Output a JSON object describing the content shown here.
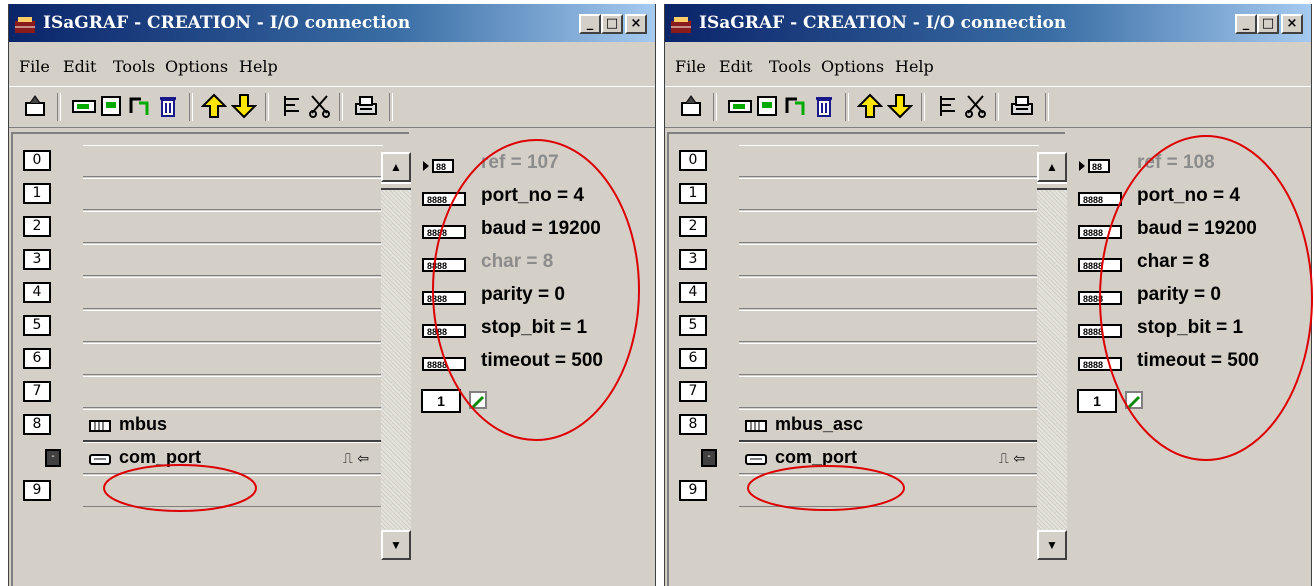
{
  "colors": {
    "titlebar_start": "#0a246a",
    "titlebar_end": "#a6caf0",
    "window": "#d4d0c8",
    "annotation": "#dd0000"
  },
  "windows": [
    {
      "title": "ISaGRAF - CREATION - I/O connection",
      "controls": {
        "minimize": "_",
        "maximize": "□",
        "close": "×"
      },
      "menu": [
        {
          "label": "File"
        },
        {
          "label": "Edit"
        },
        {
          "label": "Tools"
        },
        {
          "label": "Options"
        },
        {
          "label": "Help"
        }
      ],
      "toolbar_icons": [
        "open-icon",
        "board-connect-icon",
        "board-params-icon",
        "board-swap-icon",
        "trash-icon",
        "arrow-up-icon",
        "arrow-down-icon",
        "list-icon",
        "scissors-icon",
        "printer-icon"
      ],
      "slots": [
        {
          "num": "0",
          "name": ""
        },
        {
          "num": "1",
          "name": ""
        },
        {
          "num": "2",
          "name": ""
        },
        {
          "num": "3",
          "name": ""
        },
        {
          "num": "4",
          "name": ""
        },
        {
          "num": "5",
          "name": ""
        },
        {
          "num": "6",
          "name": ""
        },
        {
          "num": "7",
          "name": ""
        },
        {
          "num": "8",
          "name": "mbus"
        }
      ],
      "sub_board": {
        "btn": "-",
        "name": "com_port",
        "glyphs": "⎍ ⇦"
      },
      "last_slot": {
        "num": "9",
        "name": ""
      },
      "scroll": {
        "up": "▲",
        "down": "▼"
      },
      "params": [
        {
          "text": "ref = 107",
          "disabled": true
        },
        {
          "text": "port_no = 4",
          "disabled": false
        },
        {
          "text": "baud = 19200",
          "disabled": false
        },
        {
          "text": "char = 8",
          "disabled": true
        },
        {
          "text": "parity = 0",
          "disabled": false
        },
        {
          "text": "stop_bit = 1",
          "disabled": false
        },
        {
          "text": "timeout = 500",
          "disabled": false
        }
      ],
      "channel_count": "1"
    },
    {
      "title": "ISaGRAF - CREATION - I/O connection",
      "controls": {
        "minimize": "_",
        "maximize": "□",
        "close": "×"
      },
      "menu": [
        {
          "label": "File"
        },
        {
          "label": "Edit"
        },
        {
          "label": "Tools"
        },
        {
          "label": "Options"
        },
        {
          "label": "Help"
        }
      ],
      "toolbar_icons": [
        "open-icon",
        "board-connect-icon",
        "board-params-icon",
        "board-swap-icon",
        "trash-icon",
        "arrow-up-icon",
        "arrow-down-icon",
        "list-icon",
        "scissors-icon",
        "printer-icon"
      ],
      "slots": [
        {
          "num": "0",
          "name": ""
        },
        {
          "num": "1",
          "name": ""
        },
        {
          "num": "2",
          "name": ""
        },
        {
          "num": "3",
          "name": ""
        },
        {
          "num": "4",
          "name": ""
        },
        {
          "num": "5",
          "name": ""
        },
        {
          "num": "6",
          "name": ""
        },
        {
          "num": "7",
          "name": ""
        },
        {
          "num": "8",
          "name": "mbus_asc"
        }
      ],
      "sub_board": {
        "btn": "-",
        "name": "com_port",
        "glyphs": "⎍ ⇦"
      },
      "last_slot": {
        "num": "9",
        "name": ""
      },
      "scroll": {
        "up": "▲",
        "down": "▼"
      },
      "params": [
        {
          "text": "ref = 108",
          "disabled": true
        },
        {
          "text": "port_no = 4",
          "disabled": false
        },
        {
          "text": "baud = 19200",
          "disabled": false
        },
        {
          "text": "char = 8",
          "disabled": false
        },
        {
          "text": "parity = 0",
          "disabled": false
        },
        {
          "text": "stop_bit = 1",
          "disabled": false
        },
        {
          "text": "timeout = 500",
          "disabled": false
        }
      ],
      "channel_count": "1"
    }
  ]
}
